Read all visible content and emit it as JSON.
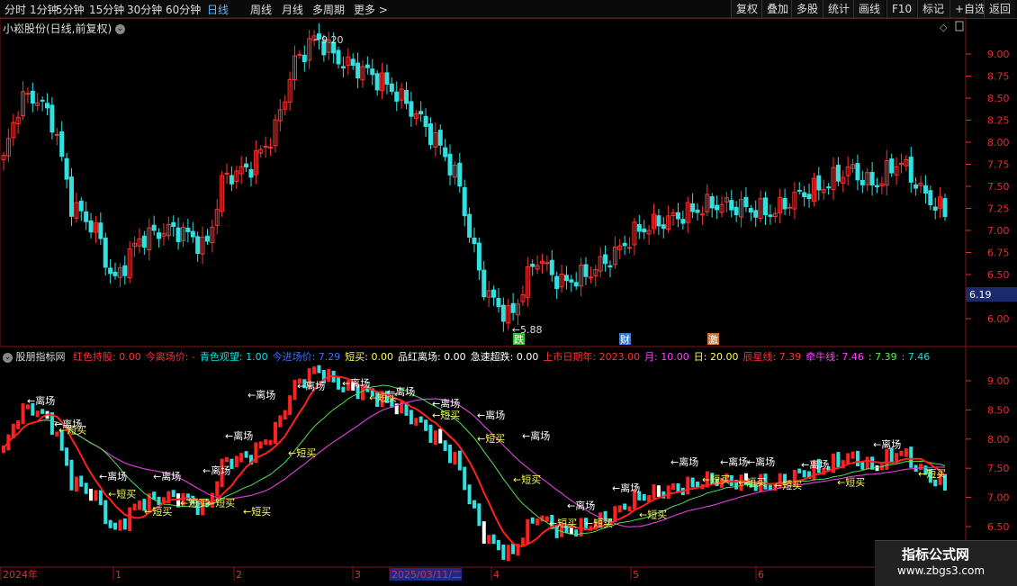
{
  "toolbar": {
    "left": [
      "分时",
      "1分钟",
      "5分钟",
      "15分钟",
      "30分钟",
      "60分钟",
      "日线",
      "周线",
      "月线",
      "多周期",
      "更多 >"
    ],
    "active": "日线",
    "right": [
      "复权",
      "叠加",
      "多股",
      "统计",
      "画线",
      "F10",
      "标记",
      "+自选",
      "返回"
    ]
  },
  "main_chart": {
    "title": "小崧股份(日线,前复权)",
    "y_ticks": [
      "9.00",
      "8.75",
      "8.50",
      "8.25",
      "8.00",
      "7.75",
      "7.50",
      "7.25",
      "7.00",
      "6.75",
      "6.50",
      "6.25",
      "6.00"
    ],
    "current_price": "6.19",
    "high_label": "9.20",
    "low_label": "5.88",
    "markers": [
      {
        "text": "跌",
        "color": "#2fbf2f"
      },
      {
        "text": "财",
        "color": "#3a7bd5"
      },
      {
        "text": "激",
        "color": "#d07030"
      }
    ]
  },
  "indicator": {
    "name": "股朋指标网",
    "items": [
      {
        "text": "红色持股: 0.00",
        "color": "#ff3030"
      },
      {
        "text": "今离场价: -",
        "color": "#ff3030"
      },
      {
        "text": "青色观望: 1.00",
        "color": "#00e5e5"
      },
      {
        "text": "今进场价: 7.29",
        "color": "#3a70ff"
      },
      {
        "text": "短买: 0.00",
        "color": "#ffff40"
      },
      {
        "text": "品红离场: 0.00",
        "color": "#ffffff"
      },
      {
        "text": "急速超跌: 0.00",
        "color": "#ffffff"
      },
      {
        "text": "上市日期年: 2023.00",
        "color": "#ff3030"
      },
      {
        "text": "月: 10.00",
        "color": "#ff40ff"
      },
      {
        "text": "日: 20.00",
        "color": "#ffff40"
      },
      {
        "text": "辰星线: 7.39",
        "color": "#ff3030"
      },
      {
        "text": "牵牛线: 7.46",
        "color": "#ff40ff"
      },
      {
        "text": ": 7.39",
        "color": "#40ff40"
      },
      {
        "text": ": 7.46",
        "color": "#00e5e5"
      }
    ],
    "y_ticks": [
      "9.00",
      "8.50",
      "8.00",
      "7.50",
      "7.00",
      "6.50"
    ],
    "exit_label": "←离场",
    "buy_label": "←短买"
  },
  "time_axis": {
    "labels": [
      "2024年",
      "1",
      "2",
      "3",
      "2025/03/11/二",
      "4",
      "5",
      "6"
    ]
  },
  "watermark": {
    "line1": "指标公式网",
    "line2": "www.zbgs3.com"
  },
  "colors": {
    "up": "#ff3333",
    "down": "#33e0e0",
    "axis": "#e03030"
  }
}
